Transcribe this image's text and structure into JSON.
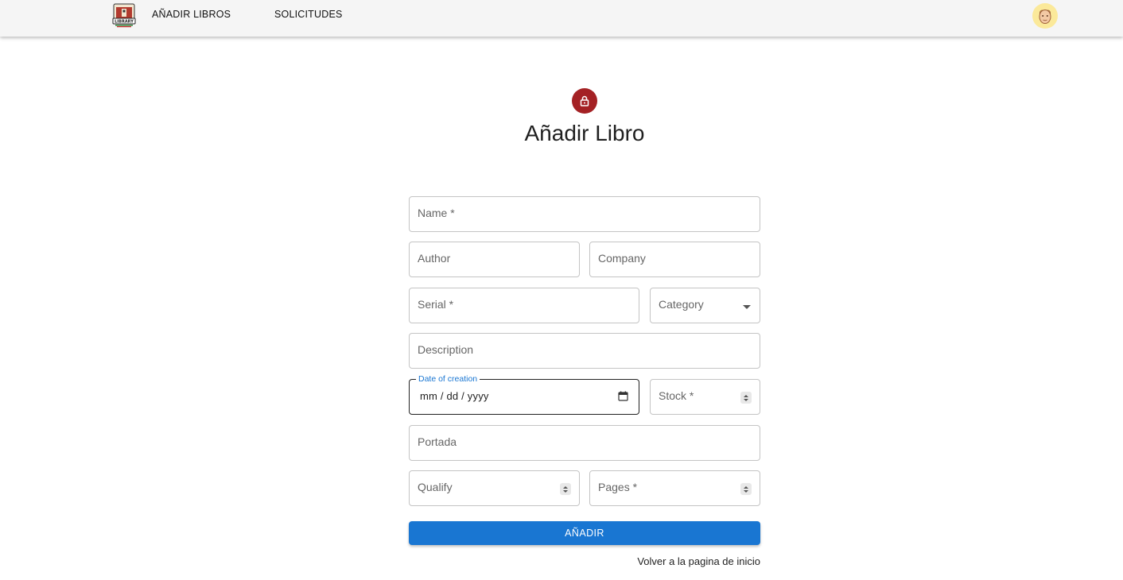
{
  "nav": {
    "logo_icon": "library-logo-icon",
    "logo_text": "LIBRARY",
    "links": [
      "AÑADIR LIBROS",
      "SOLICITUDES"
    ],
    "avatar_icon": "user-avatar-icon"
  },
  "page": {
    "lock_icon": "lock-icon",
    "title": "Añadir Libro"
  },
  "form": {
    "name_label": "Name *",
    "author_label": "Author",
    "company_label": "Company",
    "serial_label": "Serial *",
    "category_label": "Category",
    "description_label": "Description",
    "date_label": "Date of creation",
    "date_placeholder": "mm / dd / yyyy",
    "stock_label": "Stock *",
    "portada_label": "Portada",
    "qualify_label": "Qualify",
    "pages_label": "Pages *",
    "submit_label": "AÑADIR",
    "back_link": "Volver a la pagina de inicio"
  },
  "colors": {
    "primary": "#1976d2",
    "lock_bg": "#a42124",
    "appbar_bg": "#f5f5f5",
    "avatar_bg": "#fbe99a"
  }
}
